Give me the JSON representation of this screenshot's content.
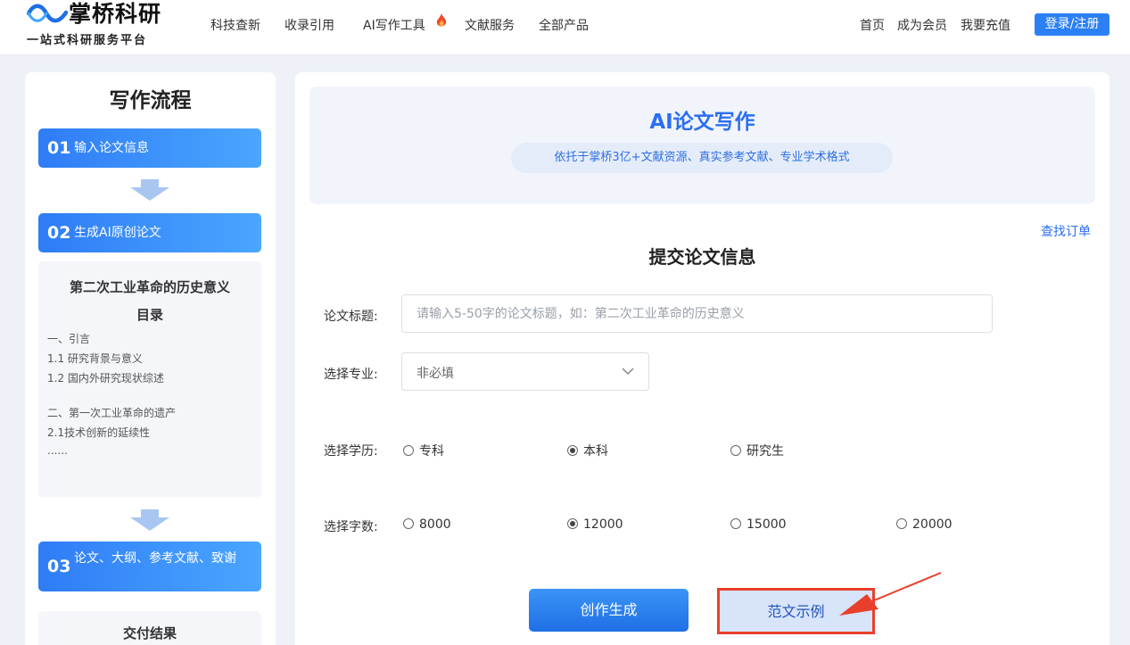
{
  "header": {
    "brand_name": "掌桥科研",
    "slogan": "一站式科研服务平台",
    "nav": [
      "科技查新",
      "收录引用",
      "AI写作工具",
      "文献服务",
      "全部产品"
    ],
    "right_links": [
      "首页",
      "成为会员",
      "我要充值"
    ],
    "login_label": "登录/注册"
  },
  "sidebar": {
    "title": "写作流程",
    "steps": [
      {
        "num": "01",
        "label": "输入论文信息"
      },
      {
        "num": "02",
        "label": "生成AI原创论文"
      },
      {
        "num": "03",
        "label": "论文、大纲、参考文献、致谢"
      }
    ],
    "toc": {
      "paper_title": "第二次工业革命的历史意义",
      "heading": "目录",
      "lines": [
        "一、引言",
        "1.1 研究背景与意义",
        "1.2 国内外研究现状综述",
        "二、第一次工业革命的遗产",
        "2.1技术创新的延续性",
        "......"
      ]
    },
    "deliver_title": "交付结果"
  },
  "main": {
    "banner_title": "AI论文写作",
    "banner_subtitle": "依托于掌桥3亿+文献资源、真实参考文献、专业学术格式",
    "find_order": "查找订单",
    "form_title": "提交论文信息",
    "fields": {
      "title_label": "论文标题:",
      "title_placeholder": "请输入5-50字的论文标题，如：第二次工业革命的历史意义",
      "major_label": "选择专业:",
      "major_value": "非必填",
      "degree_label": "选择学历:",
      "degree_options": [
        "专科",
        "本科",
        "研究生"
      ],
      "degree_selected": "本科",
      "words_label": "选择字数:",
      "words_options": [
        "8000",
        "12000",
        "15000",
        "20000"
      ],
      "words_selected": "12000"
    },
    "generate_label": "创作生成",
    "sample_label": "范文示例"
  },
  "colors": {
    "accent": "#2c80f5",
    "step_gradient_start": "#2f7cf6",
    "annotation_red": "#e8402c"
  }
}
